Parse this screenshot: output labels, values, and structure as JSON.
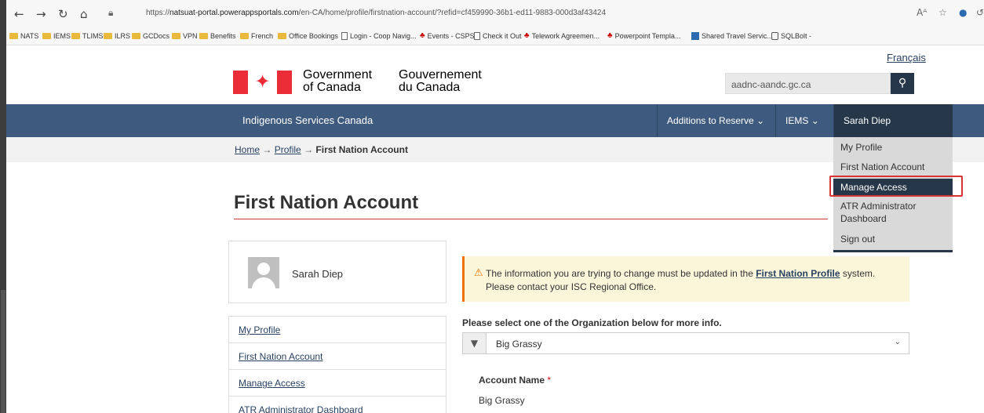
{
  "browser": {
    "url_prefix": "https://",
    "url_host": "natsuat-portal.powerappsportals.com",
    "url_path": "/en-CA/home/profile/firstnation-account/?refid=cf459990-36b1-ed11-9883-000d3af43424",
    "reader_label": "A ᴀ"
  },
  "bookmarks": [
    {
      "label": "NATS",
      "icon": "folder-icon"
    },
    {
      "label": "IEMS",
      "icon": "folder-icon"
    },
    {
      "label": "TLIMS",
      "icon": "folder-icon"
    },
    {
      "label": "ILRS",
      "icon": "folder-icon"
    },
    {
      "label": "GCDocs",
      "icon": "folder-icon"
    },
    {
      "label": "VPN",
      "icon": "folder-icon"
    },
    {
      "label": "Benefits",
      "icon": "folder-icon"
    },
    {
      "label": "French",
      "icon": "folder-icon"
    },
    {
      "label": "Office Bookings",
      "icon": "folder-icon"
    },
    {
      "label": "Login - Coop Navig...",
      "icon": "page-icon"
    },
    {
      "label": "Events - CSPS",
      "icon": "maple-leaf-icon"
    },
    {
      "label": "Check it Out",
      "icon": "page-icon"
    },
    {
      "label": "Telework Agreemen...",
      "icon": "maple-leaf-icon"
    },
    {
      "label": "Powerpoint Templa...",
      "icon": "maple-leaf-icon"
    },
    {
      "label": "Shared Travel Servic...",
      "icon": "travel-icon"
    },
    {
      "label": "SQLBolt -",
      "icon": "database-icon"
    }
  ],
  "header": {
    "language_link": "Français",
    "signature_en_1": "Government",
    "signature_en_2": "of Canada",
    "signature_fr_1": "Gouvernement",
    "signature_fr_2": "du Canada",
    "search_value": "aadnc-aandc.gc.ca"
  },
  "navbar": {
    "title": "Indigenous Services Canada",
    "items": [
      {
        "label": "Additions to Reserve"
      },
      {
        "label": "IEMS"
      },
      {
        "label": "Sarah Diep"
      }
    ]
  },
  "breadcrumb": {
    "home": "Home",
    "profile": "Profile",
    "current": "First Nation Account",
    "separator": "→"
  },
  "user_menu": {
    "items": [
      "My Profile",
      "First Nation Account",
      "Manage Access",
      "ATR Administrator",
      "Dashboard",
      "Sign out"
    ],
    "highlighted": "Manage Access",
    "highlight_color": "#d93434"
  },
  "page": {
    "title": "First Nation Account"
  },
  "profile_card": {
    "name": "Sarah Diep"
  },
  "side_menu": {
    "items": [
      "My Profile",
      "First Nation Account",
      "Manage Access",
      "ATR Administrator Dashboard"
    ]
  },
  "alert": {
    "text_before": "The information you are trying to change must be updated in the ",
    "link": "First Nation Profile",
    "text_after": " system.",
    "line2": "Please contact your ISC Regional Office."
  },
  "org_select": {
    "label": "Please select one of the Organization below for more info.",
    "value": "Big Grassy"
  },
  "account": {
    "label": "Account Name",
    "required_mark": "*",
    "value": "Big Grassy"
  },
  "colors": {
    "navbar": "#3e5a7e",
    "nav_dark": "#26374a",
    "link": "#284162",
    "flag_red": "#eb2d37",
    "alert_bg": "#fbf6da",
    "alert_border": "#ee7100"
  }
}
